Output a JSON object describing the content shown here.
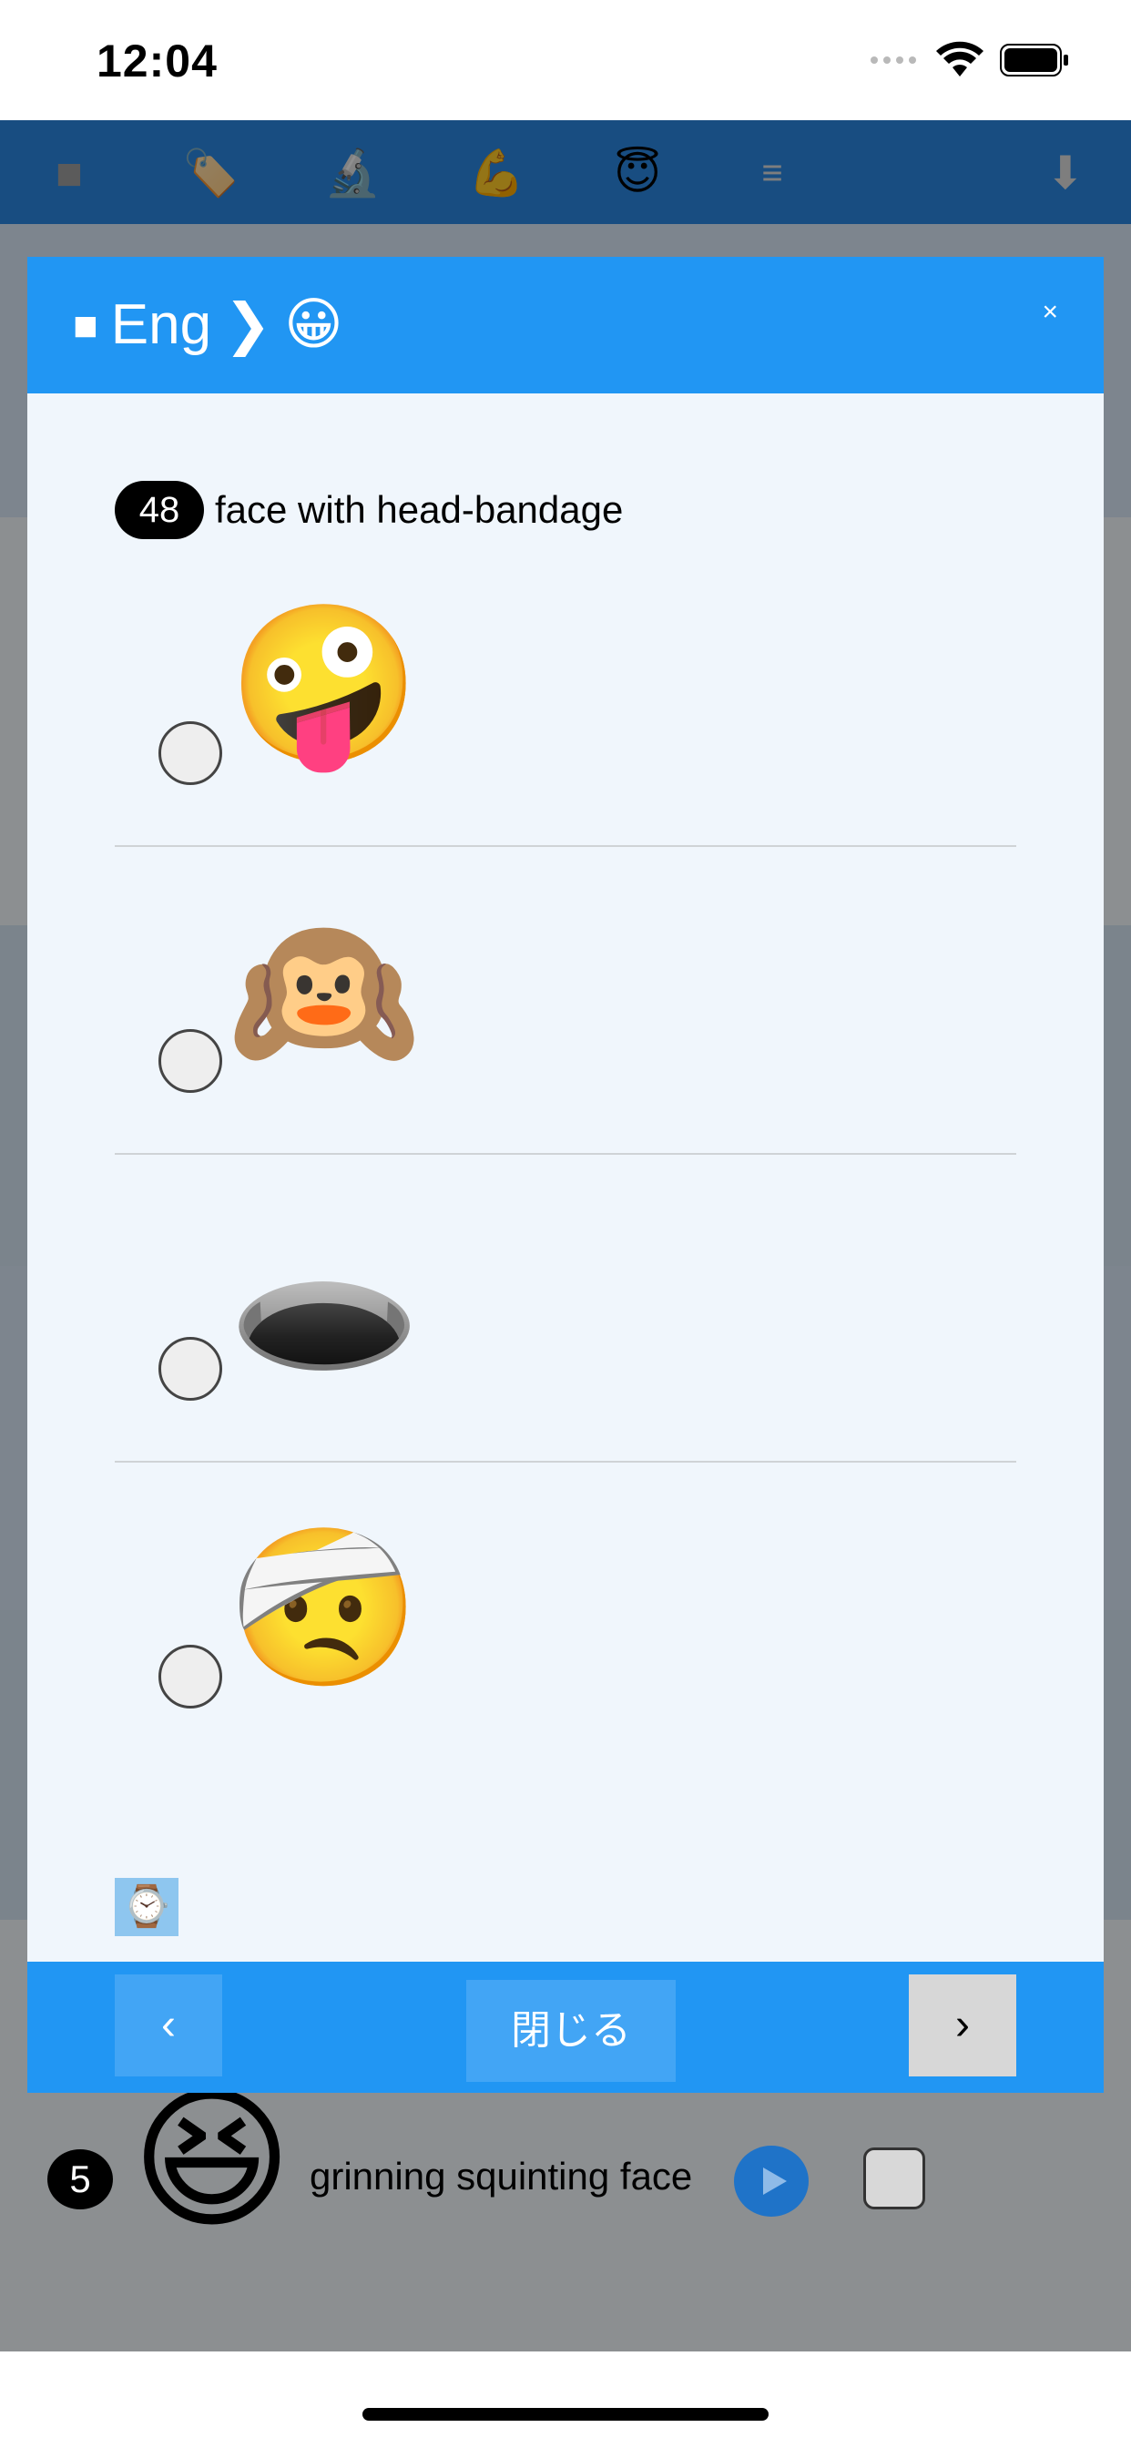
{
  "status_bar": {
    "time": "12:04"
  },
  "toolbar": {
    "icons": [
      "stop-icon",
      "label-icon",
      "microscope-icon",
      "muscle-icon",
      "halo-face-icon",
      "menu-icon",
      "download-icon"
    ],
    "glyphs": [
      "■",
      "🏷️",
      "🔬",
      "💪",
      "😇",
      "≡",
      "⬇"
    ]
  },
  "background_row": {
    "number": "5",
    "emoji": "😆",
    "label": "grinning squinting face"
  },
  "modal": {
    "title_prefix": "■",
    "title_text": "Eng",
    "title_separator": "❯",
    "title_emoji": "😀",
    "close_label": "×",
    "question": {
      "number": "48",
      "text": "face with head-bandage"
    },
    "options": [
      {
        "emoji": "🤪",
        "name": "zany face"
      },
      {
        "emoji": "🙉",
        "name": "hear-no-evil monkey"
      },
      {
        "emoji": "🕳️",
        "name": "hole"
      },
      {
        "emoji": "🤕",
        "name": "face with head-bandage"
      }
    ],
    "watch_emoji": "⌚",
    "footer": {
      "prev_label": "‹",
      "close_label": "閉じる",
      "next_label": "›"
    }
  }
}
